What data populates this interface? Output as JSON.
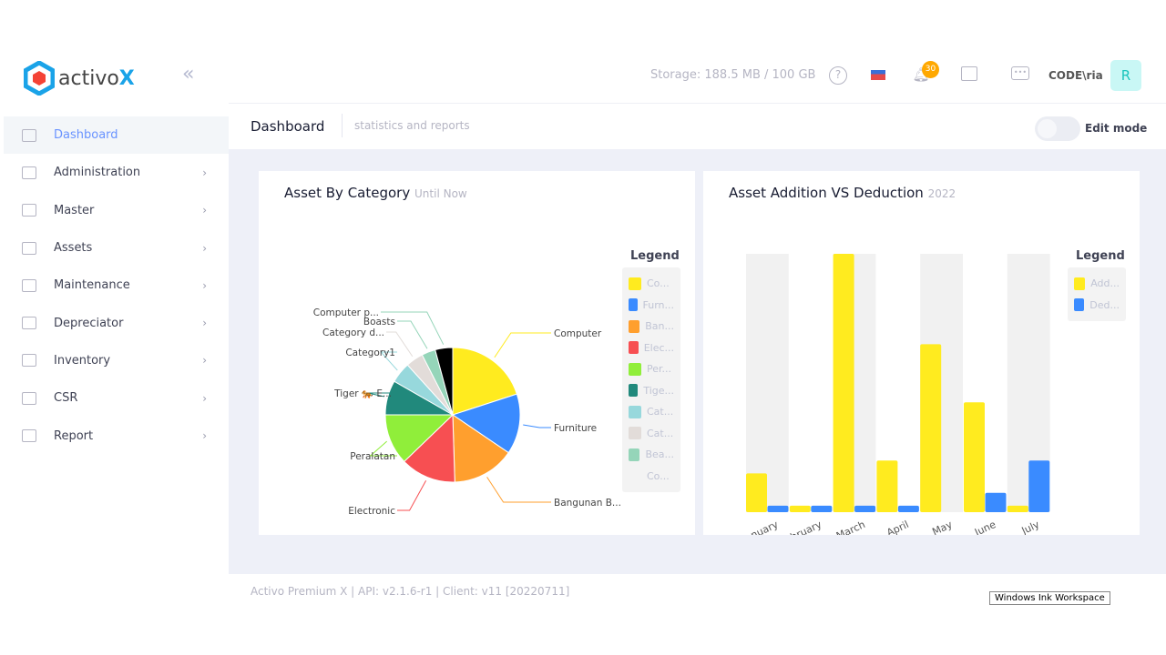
{
  "app": {
    "logo": "activo",
    "logo_x": "X"
  },
  "sidebar": {
    "items": [
      {
        "label": "Dashboard",
        "active": true
      },
      {
        "label": "Administration"
      },
      {
        "label": "Master"
      },
      {
        "label": "Assets"
      },
      {
        "label": "Maintenance"
      },
      {
        "label": "Depreciator"
      },
      {
        "label": "Inventory"
      },
      {
        "label": "CSR"
      },
      {
        "label": "Report"
      }
    ]
  },
  "topbar": {
    "storage": "Storage: 188.5 MB / 100 GB",
    "notifications": "30",
    "user": "CODE\\ria",
    "avatar": "R"
  },
  "subheader": {
    "title": "Dashboard",
    "subtitle": "statistics and reports",
    "edit_mode": "Edit mode",
    "edit_mode_on": false
  },
  "pie_card": {
    "title": "Asset By Category",
    "subtitle": "Until Now",
    "legend_title": "Legend"
  },
  "bar_card": {
    "title": "Asset Addition VS Deduction",
    "subtitle": "2022",
    "legend_title": "Legend"
  },
  "chart_data": [
    {
      "type": "pie",
      "slices": [
        {
          "label": "Computer",
          "legend": "Co...",
          "value": 20,
          "color": "#ffeb1f"
        },
        {
          "label": "Furniture",
          "legend": "Furn...",
          "value": 14.5,
          "color": "#3a8bff"
        },
        {
          "label": "Bangunan B...",
          "legend": "Ban...",
          "value": 15,
          "color": "#ff9f2e"
        },
        {
          "label": "Electronic",
          "legend": "Elec...",
          "value": 13.3,
          "color": "#f74f52"
        },
        {
          "label": "Peralatan",
          "legend": "Per...",
          "value": 12.2,
          "color": "#90ee3a"
        },
        {
          "label": "Tiger 🐅 E...",
          "legend": "Tige...",
          "value": 8.3,
          "color": "#21897c"
        },
        {
          "label": "Category1",
          "legend": "Cat...",
          "value": 5,
          "color": "#97d8dc"
        },
        {
          "label": "Category d...",
          "legend": "Cat...",
          "value": 4.2,
          "color": "#e2dcd9"
        },
        {
          "label": "Boasts",
          "legend": "Bea...",
          "value": 3.3,
          "color": "#95d5b9"
        },
        {
          "label": "Computer p...",
          "legend": "Co...",
          "value": 4.2,
          "color": "#000000"
        }
      ]
    },
    {
      "type": "bar",
      "categories": [
        "January",
        "February",
        "March",
        "April",
        "May",
        "June",
        "July"
      ],
      "series": [
        {
          "legend": "Add...",
          "color": "#ffeb1f",
          "values": [
            6,
            1,
            40,
            8,
            26,
            17,
            1
          ]
        },
        {
          "legend": "Ded...",
          "color": "#3a8bff",
          "values": [
            1,
            1,
            1,
            1,
            0,
            3,
            8
          ]
        }
      ],
      "ylim": [
        0,
        40
      ]
    }
  ],
  "footer": {
    "text": "Activo Premium X | API: v2.1.6-r1 | Client: v11 [20220711]",
    "ink": "Windows Ink Workspace"
  }
}
